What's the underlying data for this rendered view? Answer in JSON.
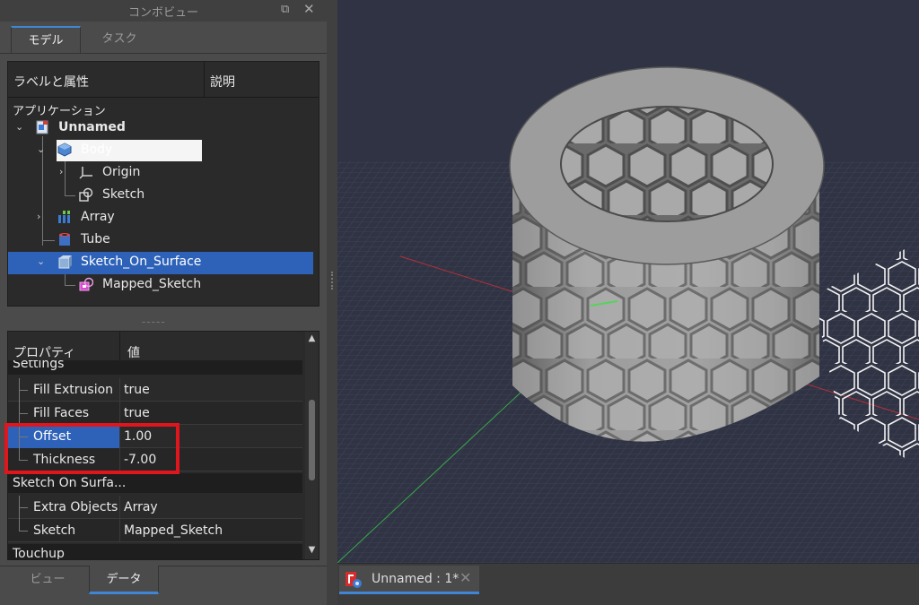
{
  "combo": {
    "title": "コンボビュー",
    "top_tabs": [
      "モデル",
      "タスク"
    ],
    "bottom_tabs": [
      "ビュー",
      "データ"
    ]
  },
  "tree": {
    "header_label": "ラベルと属性",
    "header_desc": "説明",
    "root": "アプリケーション",
    "items": [
      {
        "label": "Unnamed",
        "icon": "document-icon"
      },
      {
        "label": "Body",
        "icon": "body-icon"
      },
      {
        "label": "Origin",
        "icon": "origin-icon"
      },
      {
        "label": "Sketch",
        "icon": "sketch-icon"
      },
      {
        "label": "Array",
        "icon": "array-icon"
      },
      {
        "label": "Tube",
        "icon": "tube-icon"
      },
      {
        "label": "Sketch_On_Surface",
        "icon": "sketch-on-surface-icon"
      },
      {
        "label": "Mapped_Sketch",
        "icon": "mapped-sketch-icon"
      }
    ]
  },
  "props": {
    "header_prop": "プロパティ",
    "header_val": "値",
    "group_settings": "Settings",
    "group_sketch_on_surface": "Sketch On Surfa...",
    "group_touchup": "Touchup",
    "rows": [
      {
        "name": "Fill Extrusion",
        "value": "true"
      },
      {
        "name": "Fill Faces",
        "value": "true"
      },
      {
        "name": "Offset",
        "value": "1.00"
      },
      {
        "name": "Thickness",
        "value": "-7.00"
      },
      {
        "name": "Extra Objects",
        "value": "Array"
      },
      {
        "name": "Sketch",
        "value": "Mapped_Sketch"
      }
    ]
  },
  "document_tab": {
    "label": "Unnamed : 1*"
  },
  "colors": {
    "selection": "#2e62b8",
    "accent": "#3f87d6",
    "highlight": "#e0161c",
    "viewport_bg": "#2f3343"
  }
}
